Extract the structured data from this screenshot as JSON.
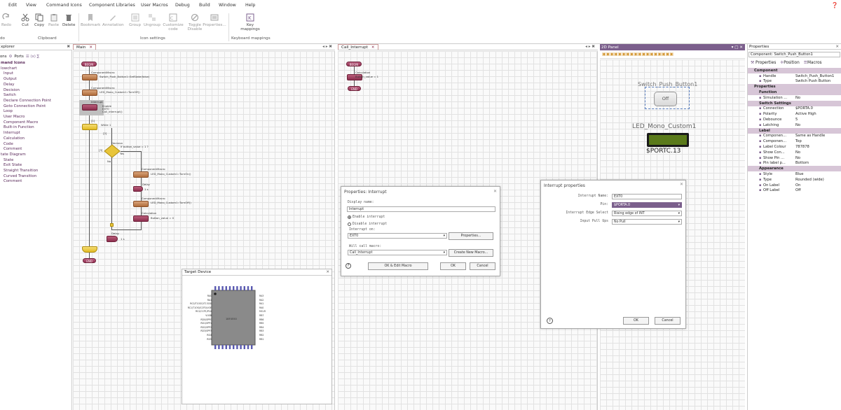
{
  "menu": [
    "Edit",
    "View",
    "Command Icons",
    "Component Libraries",
    "User Macros",
    "Debug",
    "Build",
    "Window",
    "Help"
  ],
  "ribbon": {
    "buttons": [
      {
        "label": "Redo",
        "icon": "redo-icon"
      },
      {
        "label": "Cut",
        "icon": "scissors-icon"
      },
      {
        "label": "Copy",
        "icon": "copy-icon"
      },
      {
        "label": "Paste",
        "icon": "paste-icon"
      },
      {
        "label": "Delete",
        "icon": "trash-icon"
      },
      {
        "label": "Bookmark",
        "icon": "bookmark-icon"
      },
      {
        "label": "Annotation",
        "icon": "annotation-icon"
      },
      {
        "label": "Group",
        "icon": "group-icon"
      },
      {
        "label": "Ungroup",
        "icon": "ungroup-icon"
      },
      {
        "label": "Customize code",
        "icon": "code-icon"
      },
      {
        "label": "Toggle Disable",
        "icon": "disable-icon"
      },
      {
        "label": "Properties...",
        "icon": "properties-icon"
      },
      {
        "label": "Key mappings",
        "icon": "key-icon"
      }
    ],
    "groups": [
      "do",
      "Clipboard",
      "Icon settings",
      "Keyboard mappings"
    ]
  },
  "explorer": {
    "title": "xplorer",
    "tabs": [
      "ons",
      "Ports"
    ],
    "items": [
      "mand Icons",
      "lowchart",
      "Input",
      "Output",
      "Delay",
      "Decision",
      "Switch",
      "Declare Connection Point",
      "Goto Connection Point",
      "Loop",
      "User Macro",
      "Component Macro",
      "Built-in Function",
      "Interrupt",
      "Calculation",
      "Code",
      "Comment",
      "tate Diagram",
      "State",
      "Exit State",
      "Straight Transition",
      "Curved Transition",
      "Comment"
    ]
  },
  "main_tab": "Main",
  "flow_main": {
    "begin": "BEGIN",
    "end": "END",
    "cm1_title": "ComponentMacro",
    "cm1_text": "Switch_Push_Button1::SetState(false)",
    "cm2_title": "ComponentMacro",
    "cm2_text": "LED_Mono_Custom1::TurnOff()",
    "int_title": "Interrupt",
    "int_text1": "Enable",
    "int_text2": "EXT0",
    "int_text3": "Call_Interrupt()",
    "loop_label": "While 1",
    "decision_title": "Decision",
    "decision_text": "If button_value = 1 ?",
    "yes": "Yes",
    "no": "No",
    "cm3_title": "ComponentMacro",
    "cm3_text": "LED_Mono_Custom1::TurnOn()",
    "delay1_title": "Delay",
    "delay1_text": "1 s",
    "cm4_title": "ComponentMacro",
    "cm4_text": "LED_Mono_Custom1::TurnOff()",
    "calc_title": "Calculation",
    "calc_text": "Button_value = 0",
    "delay2_title": "Delay",
    "delay2_text": "1 s",
    "loop_marker1": "[1]",
    "loop_marker2": "[2]",
    "loop_marker3": "[3]"
  },
  "target_device": {
    "title": "Target Device",
    "chip_label": "18F4550",
    "pins_left": [
      "RA0",
      "RA1",
      "RC0/T1OSO/T13CKI",
      "RC1/T1OSI/CCP2/UOE",
      "RC2/CCP1/P1A",
      "VUSB",
      "RD0/SPP0",
      "RD1/SPP1",
      "RD2/SPP2",
      "RD3/SPP3",
      "RD4",
      "RD5"
    ],
    "pins_right": [
      "RA3",
      "RA2",
      "RA1",
      "RA0",
      "MCLR",
      "RB7",
      "RB6",
      "RB5",
      "RB4",
      "RB3",
      "RB2",
      "RB1"
    ]
  },
  "call_tab": "Call_Interrupt",
  "flow_call": {
    "begin": "BEGIN",
    "calc_title": "Calculation",
    "calc_text": "Button_value = 1",
    "end": "END"
  },
  "panel2d": {
    "title": "2D Panel",
    "switch_label": "Switch_Push_Button1",
    "switch_state": "Off",
    "led_label": "LED_Mono_Custom1",
    "led_port": "$PORTC.13"
  },
  "dialog1": {
    "title": "Properties: Interrupt",
    "display_name_label": "Display name:",
    "display_name": "Interrupt",
    "enable_label": "Enable interrupt",
    "disable_label": "Disable interrupt",
    "interrupt_on_label": "Interrupt on:",
    "interrupt_on": "EXT0",
    "properties_btn": "Properties...",
    "will_call_label": "Will call macro:",
    "will_call": "Call_Interrupt",
    "create_btn": "Create New Macro...",
    "ok_edit_btn": "OK & Edit Macro",
    "ok_btn": "OK",
    "cancel_btn": "Cancel"
  },
  "dialog2": {
    "title": "Interrupt properties",
    "rows": [
      {
        "label": "Interrupt Name:",
        "value": "EXT0"
      },
      {
        "label": "Pin:",
        "value": "$PORTA.0"
      },
      {
        "label": "Interrupt Edge Select",
        "value": "Rising edge of INT"
      },
      {
        "label": "Input Pull Ups",
        "value": "No Pull"
      }
    ],
    "ok_btn": "OK",
    "cancel_btn": "Cancel"
  },
  "properties": {
    "title": "Properties",
    "component": "Component: Switch_Push_Button1",
    "tabs": [
      "Properties",
      "Position",
      "Macros"
    ],
    "rows": [
      {
        "cat": true,
        "key": "Component"
      },
      {
        "key": "Handle",
        "value": "Switch_Push_Button1"
      },
      {
        "key": "Type",
        "value": "Switch Push Button"
      },
      {
        "cat": true,
        "key": "Properties"
      },
      {
        "cat": true,
        "key": "Function",
        "sub": true
      },
      {
        "key": "Simulation ...",
        "value": "No"
      },
      {
        "cat": true,
        "key": "Switch Settings",
        "sub": true
      },
      {
        "key": "Connection",
        "value": "$PORTA.0"
      },
      {
        "key": "Polarity",
        "value": "Active High"
      },
      {
        "key": "Debounce",
        "value": "5"
      },
      {
        "key": "Latching",
        "value": "No"
      },
      {
        "cat": true,
        "key": "Label",
        "sub": true
      },
      {
        "key": "Componen...",
        "value": "Same as Handle"
      },
      {
        "key": "Componen...",
        "value": "Top"
      },
      {
        "key": "Label Colour",
        "value": "787878"
      },
      {
        "key": "Show Con...",
        "value": "No"
      },
      {
        "key": "Show Pin ...",
        "value": "No"
      },
      {
        "key": "Pin label p...",
        "value": "Bottom"
      },
      {
        "cat": true,
        "key": "Appearance",
        "sub": true
      },
      {
        "key": "Style",
        "value": "Blue"
      },
      {
        "key": "Type",
        "value": "Rounded (wide)"
      },
      {
        "key": "On Label",
        "value": "On"
      },
      {
        "key": "Off Label",
        "value": "Off"
      }
    ]
  },
  "colors": {
    "accent": "#7b5f8c",
    "block_macro": "#c27f4f",
    "block_calc": "#9a3a5a",
    "block_loop": "#e8c53a",
    "led_green": "#5a7a1a"
  }
}
